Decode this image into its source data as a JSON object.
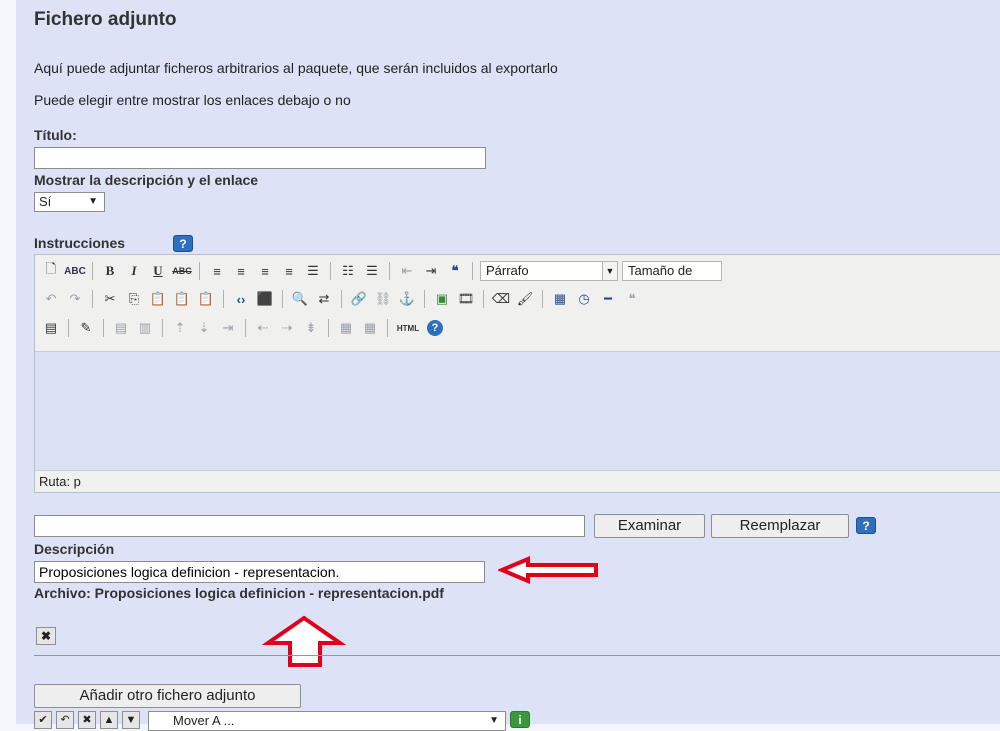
{
  "section": {
    "title": "Fichero adjunto",
    "intro": "Aquí puede adjuntar ficheros arbitrarios al paquete, que serán incluidos al exportarlo",
    "links_note": "Puede elegir entre mostrar los enlaces debajo o no"
  },
  "title_field": {
    "label": "Título:",
    "value": ""
  },
  "show_desc": {
    "label": "Mostrar la descripción y el enlace",
    "selected": "Sí"
  },
  "instructions": {
    "label": "Instrucciones",
    "toolbar": {
      "format_select": "Párrafo",
      "size_select": "Tamaño de",
      "icons_row1": [
        "new-document-icon",
        "spellcheck-icon",
        "bold-icon",
        "italic-icon",
        "underline-icon",
        "strikethrough-icon",
        "align-left-icon",
        "align-center-icon",
        "align-right-icon",
        "align-justify-icon",
        "style-icon",
        "bullet-list-icon",
        "numbered-list-icon",
        "outdent-icon",
        "indent-icon",
        "blockquote-icon"
      ],
      "icons_row2": [
        "undo-icon",
        "redo-icon",
        "cut-icon",
        "copy-icon",
        "paste-icon",
        "paste-text-icon",
        "paste-word-icon",
        "code-icon",
        "fullscreen-icon",
        "find-icon",
        "replace-icon",
        "link-icon",
        "unlink-icon",
        "anchor-icon",
        "image-icon",
        "media-icon",
        "eraser-icon",
        "cleanup-icon",
        "date-icon",
        "time-icon",
        "hr-icon",
        "quote-icon"
      ],
      "icons_row3": [
        "table-icon",
        "edit-icon",
        "table-row-icon",
        "table-col-icon",
        "insert-row-before-icon",
        "insert-row-after-icon",
        "delete-row-icon",
        "insert-col-before-icon",
        "insert-col-after-icon",
        "delete-col-icon",
        "merge-cells-icon",
        "split-cells-icon",
        "html-icon",
        "help-icon"
      ],
      "html_label": "HTML"
    },
    "path_label": "Ruta: p"
  },
  "file": {
    "path_value": "",
    "browse_label": "Examinar",
    "replace_label": "Reemplazar",
    "desc_label": "Descripción",
    "desc_value": "Proposiciones logica definicion - representacion.",
    "archive_label": "Archivo: Proposiciones logica definicion - representacion.pdf"
  },
  "add_button": "Añadir otro fichero adjunto",
  "move_select": "Mover A ...",
  "help_glyph": "?",
  "info_glyph": "i",
  "colors": {
    "panel": "#dde2f7",
    "arrow": "#e0001a",
    "help": "#2f6fbf"
  }
}
